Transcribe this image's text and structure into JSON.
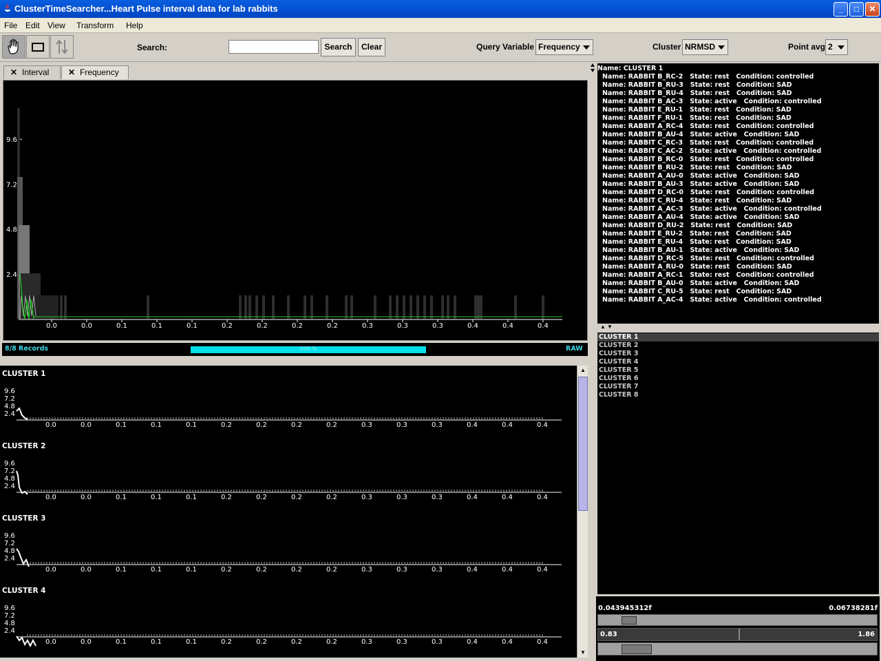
{
  "window": {
    "title": "ClusterTimeSearcher...Heart Pulse interval data for lab rabbits"
  },
  "menu": {
    "items": [
      "File",
      "Edit",
      "View",
      "Transform",
      "Help"
    ]
  },
  "toolbar": {
    "search_label": "Search:",
    "search_value": "",
    "search_button": "Search",
    "clear_button": "Clear",
    "query_variable_label": "Query Variable",
    "query_variable_value": "Frequency",
    "cluster_label": "Cluster",
    "cluster_value": "NRMSD",
    "point_avg_label": "Point avg",
    "point_avg_value": "2"
  },
  "tabs": [
    {
      "label": "Interval",
      "selected": false
    },
    {
      "label": "Frequency",
      "selected": true
    }
  ],
  "status": {
    "records": "8/8 Records",
    "progress_label": "100 %",
    "progress": 1.0,
    "mode": "RAW"
  },
  "chart_data": [
    {
      "type": "line",
      "name": "main-frequency-chart",
      "y_ticks": [
        "9.6",
        "7.2",
        "4.8",
        "2.4"
      ],
      "x_ticks": [
        "0.0",
        "0.0",
        "0.1",
        "0.1",
        "0.1",
        "0.2",
        "0.2",
        "0.2",
        "0.2",
        "0.3",
        "0.3",
        "0.3",
        "0.4",
        "0.4",
        "0.4"
      ],
      "ylim": [
        0,
        12
      ],
      "line_color": "#22cc22"
    },
    {
      "type": "line",
      "name": "cluster-thumbnails",
      "clusters": [
        {
          "label": "CLUSTER 1",
          "y_ticks": [
            "9.6",
            "7.2",
            "4.8",
            "2.4"
          ],
          "x_ticks": [
            "0.0",
            "0.0",
            "0.1",
            "0.1",
            "0.1",
            "0.2",
            "0.2",
            "0.2",
            "0.2",
            "0.3",
            "0.3",
            "0.3",
            "0.4",
            "0.4",
            "0.4"
          ]
        },
        {
          "label": "CLUSTER 2",
          "y_ticks": [
            "9.6",
            "7.2",
            "4.8",
            "2.4"
          ],
          "x_ticks": [
            "0.0",
            "0.0",
            "0.1",
            "0.1",
            "0.1",
            "0.2",
            "0.2",
            "0.2",
            "0.2",
            "0.3",
            "0.3",
            "0.3",
            "0.4",
            "0.4",
            "0.4"
          ]
        },
        {
          "label": "CLUSTER 3",
          "y_ticks": [
            "9.6",
            "7.2",
            "4.8",
            "2.4"
          ],
          "x_ticks": [
            "0.0",
            "0.0",
            "0.1",
            "0.1",
            "0.1",
            "0.2",
            "0.2",
            "0.2",
            "0.2",
            "0.3",
            "0.3",
            "0.3",
            "0.4",
            "0.4",
            "0.4"
          ]
        },
        {
          "label": "CLUSTER 4",
          "y_ticks": [
            "9.6",
            "7.2",
            "4.8",
            "2.4"
          ],
          "x_ticks": [
            "0.0",
            "0.0",
            "0.1",
            "0.1",
            "0.1",
            "0.2",
            "0.2",
            "0.2",
            "0.2",
            "0.3",
            "0.3",
            "0.3",
            "0.4",
            "0.4",
            "0.4"
          ]
        }
      ]
    }
  ],
  "cluster_info": {
    "header": "Name: CLUSTER 1",
    "records": [
      "Name: RABBIT B_RC-2   State: rest   Condition: controlled",
      "Name: RABBIT B_RU-3   State: rest   Condition: SAD",
      "Name: RABBIT B_RU-4   State: rest   Condition: SAD",
      "Name: RABBIT B_AC-3   State: active   Condition: controlled",
      "Name: RABBIT E_RU-1   State: rest   Condition: SAD",
      "Name: RABBIT F_RU-1   State: rest   Condition: SAD",
      "Name: RABBIT A_RC-4   State: rest   Condition: controlled",
      "Name: RABBIT B_AU-4   State: active   Condition: SAD",
      "Name: RABBIT C_RC-3   State: rest   Condition: controlled",
      "Name: RABBIT C_AC-2   State: active   Condition: controlled",
      "Name: RABBIT B_RC-0   State: rest   Condition: controlled",
      "Name: RABBIT B_RU-2   State: rest   Condition: SAD",
      "Name: RABBIT A_AU-0   State: active   Condition: SAD",
      "Name: RABBIT B_AU-3   State: active   Condition: SAD",
      "Name: RABBIT D_RC-0   State: rest   Condition: controlled",
      "Name: RABBIT C_RU-4   State: rest   Condition: SAD",
      "Name: RABBIT A_AC-3   State: active   Condition: controlled",
      "Name: RABBIT A_AU-4   State: active   Condition: SAD",
      "Name: RABBIT D_RU-2   State: rest   Condition: SAD",
      "Name: RABBIT E_RU-2   State: rest   Condition: SAD",
      "Name: RABBIT E_RU-4   State: rest   Condition: SAD",
      "Name: RABBIT B_AU-1   State: active   Condition: SAD",
      "Name: RABBIT D_RC-5   State: rest   Condition: controlled",
      "Name: RABBIT A_RU-0   State: rest   Condition: SAD",
      "Name: RABBIT A_RC-1   State: rest   Condition: controlled",
      "Name: RABBIT B_AU-0   State: active   Condition: SAD",
      "Name: RABBIT C_RU-5   State: rest   Condition: SAD",
      "Name: RABBIT A_AC-4   State: active   Condition: controlled"
    ]
  },
  "cluster_list": [
    "CLUSTER 1",
    "CLUSTER 2",
    "CLUSTER 3",
    "CLUSTER 4",
    "CLUSTER 5",
    "CLUSTER 6",
    "CLUSTER 7",
    "CLUSTER 8"
  ],
  "range": {
    "top_min": "0.043945312f",
    "top_max": "0.06738281f",
    "bottom_min": "0.83",
    "bottom_max": "1.86"
  }
}
